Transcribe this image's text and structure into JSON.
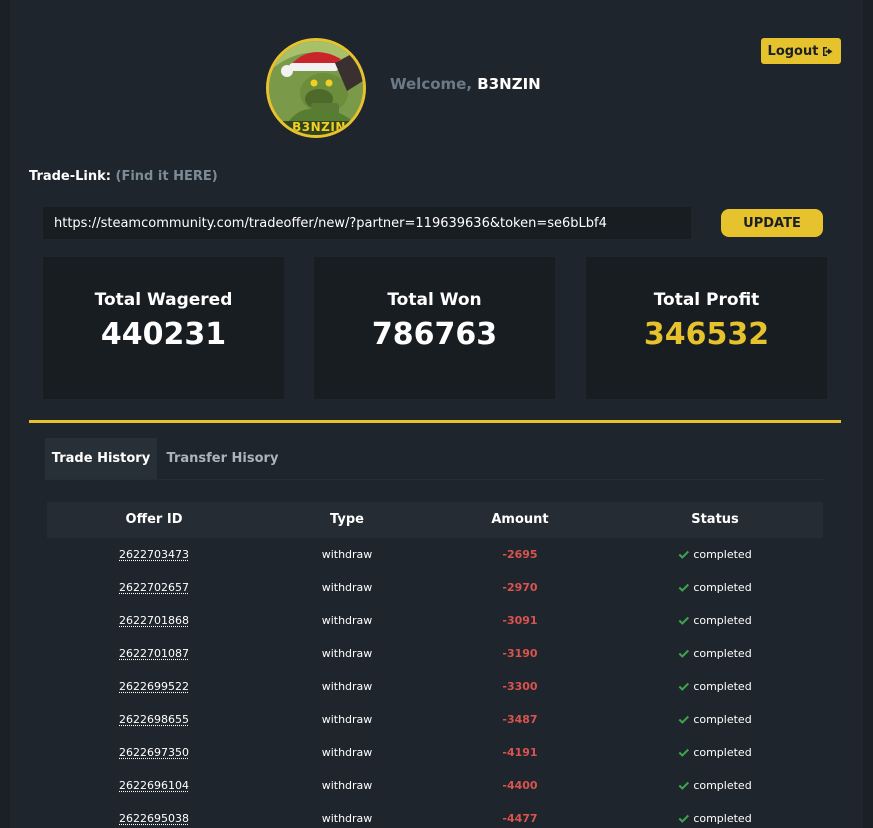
{
  "header": {
    "welcome_prefix": "Welcome,",
    "username": "B3NZIN",
    "avatar_text": "B3NZIN",
    "logout_label": "Logout"
  },
  "tradelink": {
    "label": "Trade-Link:",
    "find_label": "(Find it HERE)",
    "value": "https://steamcommunity.com/tradeoffer/new/?partner=119639636&token=se6bLbf4",
    "update_label": "UPDATE"
  },
  "stats": [
    {
      "label": "Total Wagered",
      "value": "440231"
    },
    {
      "label": "Total Won",
      "value": "786763"
    },
    {
      "label": "Total Profit",
      "value": "346532"
    }
  ],
  "tabs": [
    {
      "label": "Trade History",
      "active": true
    },
    {
      "label": "Transfer Hisory",
      "active": false
    }
  ],
  "table": {
    "headers": [
      "Offer ID",
      "Type",
      "Amount",
      "Status"
    ],
    "rows": [
      {
        "offer_id": "2622703473",
        "type": "withdraw",
        "amount": "-2695",
        "status": "completed"
      },
      {
        "offer_id": "2622702657",
        "type": "withdraw",
        "amount": "-2970",
        "status": "completed"
      },
      {
        "offer_id": "2622701868",
        "type": "withdraw",
        "amount": "-3091",
        "status": "completed"
      },
      {
        "offer_id": "2622701087",
        "type": "withdraw",
        "amount": "-3190",
        "status": "completed"
      },
      {
        "offer_id": "2622699522",
        "type": "withdraw",
        "amount": "-3300",
        "status": "completed"
      },
      {
        "offer_id": "2622698655",
        "type": "withdraw",
        "amount": "-3487",
        "status": "completed"
      },
      {
        "offer_id": "2622697350",
        "type": "withdraw",
        "amount": "-4191",
        "status": "completed"
      },
      {
        "offer_id": "2622696104",
        "type": "withdraw",
        "amount": "-4400",
        "status": "completed"
      },
      {
        "offer_id": "2622695038",
        "type": "withdraw",
        "amount": "-4477",
        "status": "completed"
      }
    ]
  },
  "colors": {
    "accent": "#e6c22d",
    "negative": "#d9534f",
    "success": "#3fa34d",
    "background": "#1e252c"
  },
  "icons": {
    "logout": "sign-out-icon",
    "status": "check-icon"
  }
}
